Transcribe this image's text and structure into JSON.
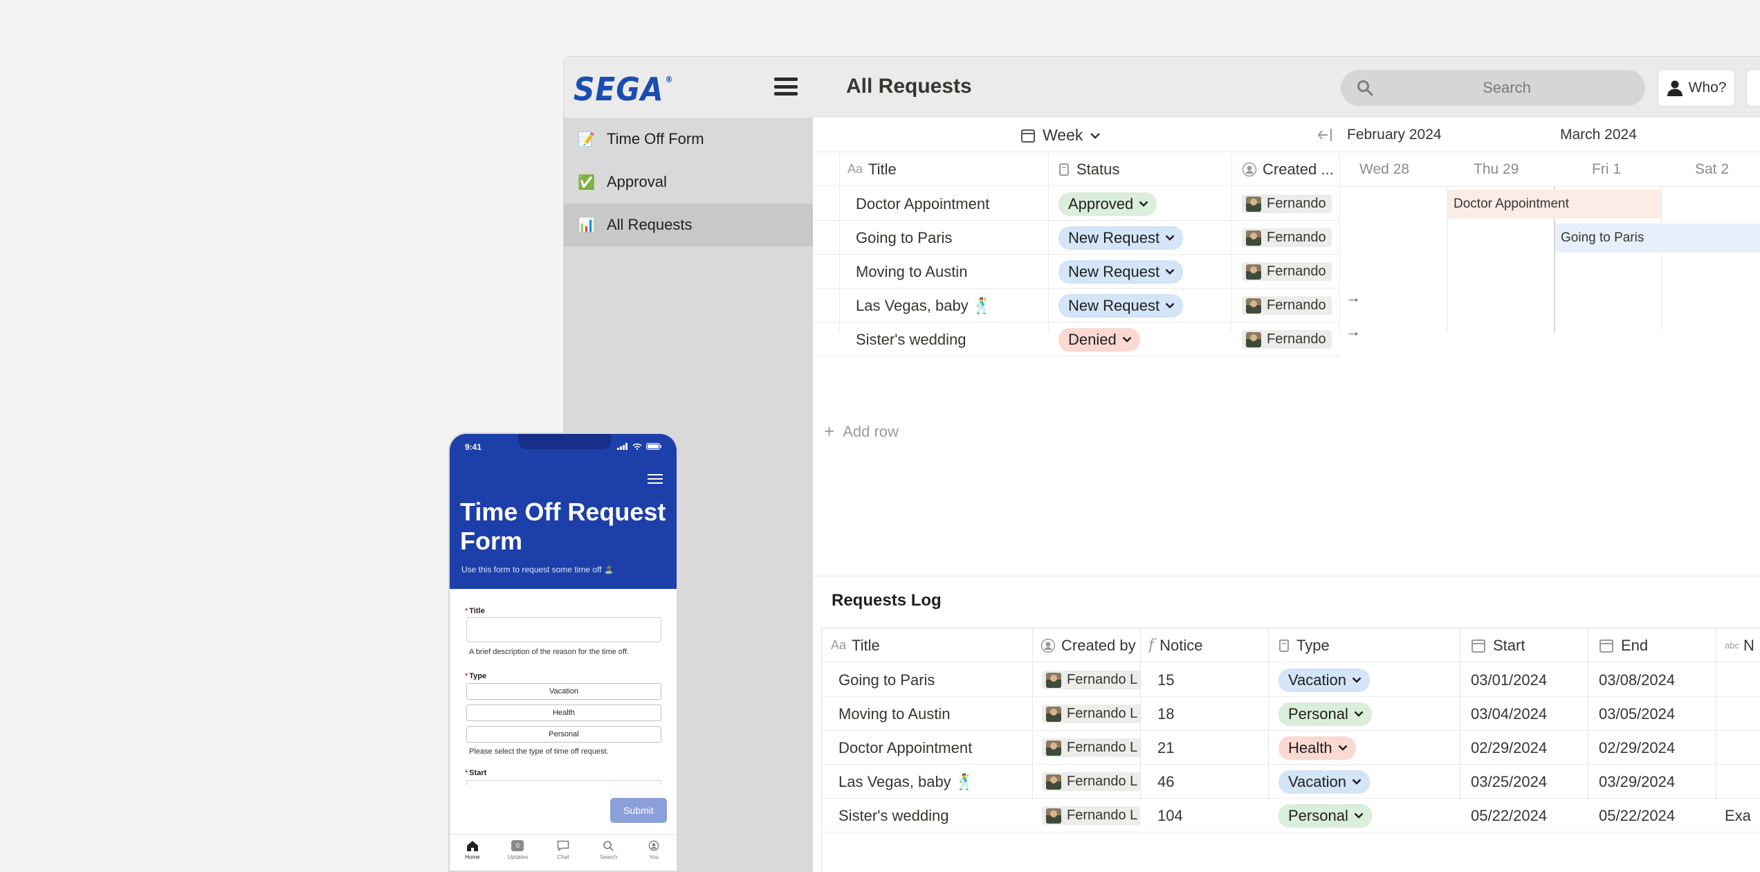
{
  "app": {
    "logo": "SEGA",
    "logo_mark": "®",
    "page_title": "All Requests",
    "search_placeholder": "Search",
    "who_label": "Who?"
  },
  "sidebar": {
    "items": [
      {
        "label": "Time Off Form",
        "icon": "memo-icon",
        "glyph": "📝"
      },
      {
        "label": "Approval",
        "icon": "check-mark-icon",
        "glyph": "✅"
      },
      {
        "label": "All Requests",
        "icon": "bar-chart-icon",
        "glyph": "📊",
        "active": true
      }
    ]
  },
  "timeline": {
    "view_label": "Week",
    "months": [
      "February 2024",
      "March 2024"
    ],
    "days": [
      "Wed 28",
      "Thu 29",
      "Fri 1",
      "Sat 2"
    ],
    "columns": {
      "title": "Title",
      "status": "Status",
      "created": "Created ..."
    },
    "rows": [
      {
        "title": "Doctor Appointment",
        "status": "Approved",
        "status_color": "green",
        "created_by": "Fernando"
      },
      {
        "title": "Going to Paris",
        "status": "New Request",
        "status_color": "blue",
        "created_by": "Fernando"
      },
      {
        "title": "Moving to Austin",
        "status": "New Request",
        "status_color": "blue",
        "created_by": "Fernando"
      },
      {
        "title": "Las Vegas, baby 🕺",
        "status": "New Request",
        "status_color": "blue",
        "created_by": "Fernando"
      },
      {
        "title": "Sister's wedding",
        "status": "Denied",
        "status_color": "red",
        "created_by": "Fernando"
      }
    ],
    "bars": [
      {
        "label": "Doctor Appointment",
        "color": "#fbece8"
      },
      {
        "label": "Going to Paris",
        "color": "#e7f0fa"
      }
    ],
    "add_row": "Add row"
  },
  "log": {
    "title": "Requests Log",
    "columns": {
      "title": "Title",
      "created_by": "Created by",
      "notice": "Notice",
      "type": "Type",
      "start": "Start",
      "end": "End",
      "extra": "N"
    },
    "rows": [
      {
        "title": "Going to Paris",
        "created_by": "Fernando L",
        "notice": "15",
        "type": "Vacation",
        "type_color": "blue",
        "start": "03/01/2024",
        "end": "03/08/2024",
        "extra": ""
      },
      {
        "title": "Moving to Austin",
        "created_by": "Fernando L",
        "notice": "18",
        "type": "Personal",
        "type_color": "green",
        "start": "03/04/2024",
        "end": "03/05/2024",
        "extra": ""
      },
      {
        "title": "Doctor Appointment",
        "created_by": "Fernando L",
        "notice": "21",
        "type": "Health",
        "type_color": "red",
        "start": "02/29/2024",
        "end": "02/29/2024",
        "extra": ""
      },
      {
        "title": "Las Vegas, baby 🕺",
        "created_by": "Fernando L",
        "notice": "46",
        "type": "Vacation",
        "type_color": "blue",
        "start": "03/25/2024",
        "end": "03/29/2024",
        "extra": ""
      },
      {
        "title": "Sister's wedding",
        "created_by": "Fernando L",
        "notice": "104",
        "type": "Personal",
        "type_color": "green",
        "start": "05/22/2024",
        "end": "05/22/2024",
        "extra": "Exa"
      }
    ]
  },
  "phone": {
    "time": "9:41",
    "title": "Time Off Request Form",
    "subtitle": "Use this form to request some time off 🏝️",
    "fields": {
      "title_label": "Title",
      "title_help": "A brief description of the reason for the time off.",
      "type_label": "Type",
      "type_options": [
        "Vacation",
        "Health",
        "Personal"
      ],
      "type_help": "Please select the type of time off request.",
      "start_label": "Start"
    },
    "submit": "Submit",
    "nav": [
      {
        "label": "Home",
        "icon": "home-icon",
        "active": true
      },
      {
        "label": "Updates",
        "icon": "updates-icon",
        "badge": "0"
      },
      {
        "label": "Chat",
        "icon": "chat-icon"
      },
      {
        "label": "Search",
        "icon": "search-icon"
      },
      {
        "label": "You",
        "icon": "profile-icon"
      }
    ]
  }
}
